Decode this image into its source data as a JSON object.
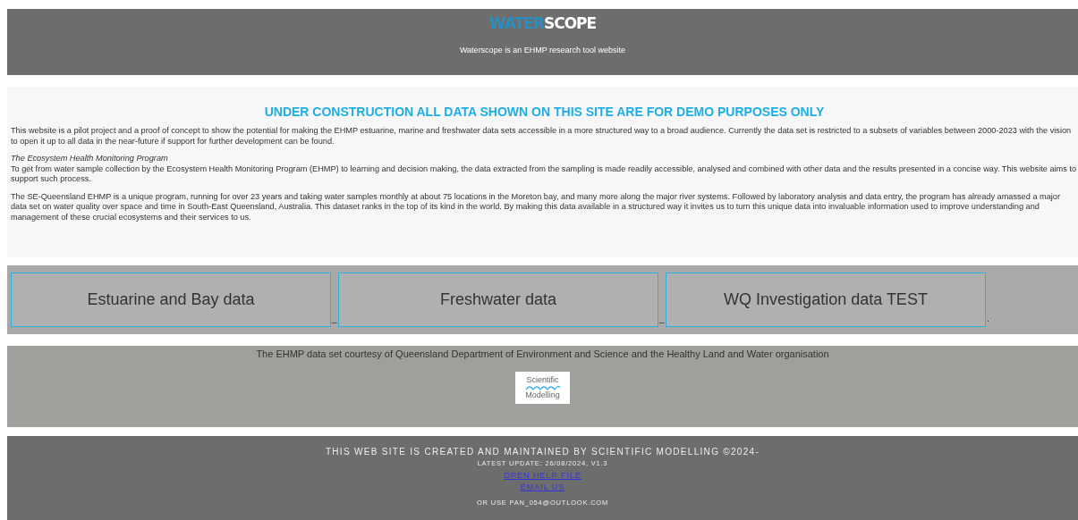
{
  "header": {
    "logo": {
      "part_1": "WATER",
      "part_2": "SCOPE"
    },
    "tagline": "Waterscope is an EHMP research tool website"
  },
  "intro": {
    "heading": "UNDER CONSTRUCTION ALL DATA SHOWN ON THIS SITE ARE FOR DEMO PURPOSES ONLY",
    "paragraph_1": "This website is a pilot project and a proof of concept to show the potential for making the EHMP estuarine, marine and freshwater data sets accessible in a more structured way to a broad audience. Currently the data set is restricted to a subsets of variables between 2000-2023 with the vision to open it up to all data in the near-future if support for further development can be found.",
    "subheading": "The Ecosystem Health Monitoring Program",
    "paragraph_2": "To get from water sample collection by the Ecosystem Health Monitoring Program (EHMP) to learning and decision making, the data extracted from the sampling is made readily accessible, analysed and combined with other data and the results presented in a concise way. This website aims to support such process.",
    "paragraph_3": "The SE-Queensland EHMP is a unique program, running for over 23 years and taking water samples monthly at about 75 locations in the Moreton bay, and many more along the major river systems. Followed by laboratory analysis and data entry, the program has already amassed a major data set on water quality over space and time in South-East Queensland, Australia. This dataset ranks in the top of its kind in the world. By making this data available in a structured way it invites us to turn this unique data into invaluable information used to improve understanding and management of these crucial ecosystems and their services to us."
  },
  "data_buttons": [
    {
      "label": "Estuarine and Bay data",
      "trailing": "_"
    },
    {
      "label": "Freshwater data",
      "trailing": "_"
    },
    {
      "label": "WQ Investigation data TEST",
      "trailing": "."
    }
  ],
  "credits": {
    "text": "The EHMP data set courtesy of Queensland Department of Environment and Science and the Healthy Land and Water organisation",
    "logo": {
      "line_1": "Scientific",
      "line_2": "Modelling"
    }
  },
  "footer": {
    "line_1": "THIS WEB SITE IS CREATED AND MAINTAINED BY SCIENTIFIC MODELLING ©2024-",
    "line_2": "LATEST UPDATE: 26/08/2024, V1.3",
    "links": [
      "OPEN HELP FILE",
      "EMAIL US"
    ],
    "contact": "OR USE PAN_054@OUTLOOK.COM"
  }
}
